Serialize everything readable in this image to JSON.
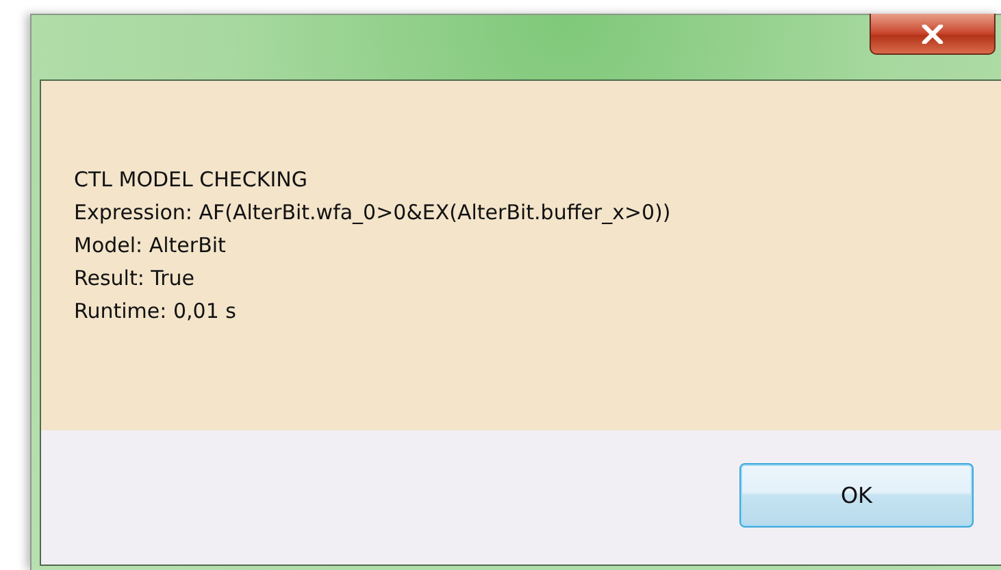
{
  "dialog": {
    "lines": [
      "CTL MODEL CHECKING",
      "Expression: AF(AlterBit.wfa_0>0&EX(AlterBit.buffer_x>0))",
      "Model: AlterBit",
      "Result: True",
      "Runtime: 0,01 s"
    ]
  },
  "buttons": [
    "OK"
  ]
}
